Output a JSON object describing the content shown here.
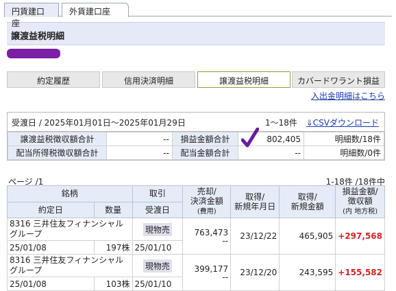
{
  "tabs": [
    "円貨建口座",
    "外貨建口座"
  ],
  "page_title": "譲渡益税明細",
  "nav": [
    "約定履歴",
    "信用決済明細",
    "譲渡益税明細",
    "カバードワラント損益"
  ],
  "link": "入出金明細はこちら",
  "summary": {
    "date_range": "受渡日 / 2025年01月01日〜2025年01月29日",
    "count": "1〜18件",
    "csv": "CSVダウンロード",
    "rows": [
      {
        "l1": "譲渡益税徴収額合計",
        "v1": "--",
        "l2": "損益金額合計",
        "v2": "802,405",
        "c": "明細数/18件"
      },
      {
        "l1": "配当所得税徴収額合計",
        "v1": "--",
        "l2": "配当金額合計",
        "v2": "--",
        "c": "明細数/0件"
      }
    ]
  },
  "page_info": "ページ /1",
  "page_range": "1-18件 /18件中",
  "detail": {
    "headers": {
      "stock": "銘柄",
      "trade": "取引",
      "sell": "売却/",
      "sell2": "決済金額",
      "sell3": "(費用)",
      "acq_date": "取得/",
      "acq_date2": "新規年月日",
      "acq_amt": "取得/",
      "acq_amt2": "新規金額",
      "pl": "損益金額/",
      "pl2": "徴収額",
      "pl3": "(内 地方税)",
      "contract": "約定日",
      "qty": "数量",
      "delivery": "受渡日"
    },
    "rows": [
      {
        "name": "8316 三井住友フィナンシャルグループ",
        "trade": "現物売",
        "sell": "763,473",
        "fee": "--",
        "acq_date": "23/12/22",
        "acq_amt": "465,905",
        "pl": "+297,568",
        "contract": "25/01/08",
        "qty": "197株",
        "delivery": "25/01/10"
      },
      {
        "name": "8316 三井住友フィナンシャルグループ",
        "trade": "現物売",
        "sell": "399,177",
        "fee": "--",
        "acq_date": "23/12/20",
        "acq_amt": "243,595",
        "pl": "+155,582",
        "contract": "25/01/08",
        "qty": "103株",
        "delivery": "25/01/10"
      }
    ]
  }
}
